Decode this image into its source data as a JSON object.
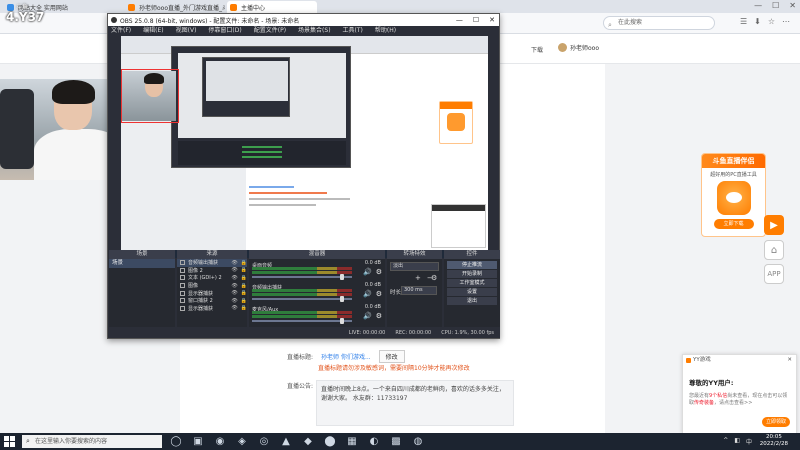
{
  "browser": {
    "tabs": [
      {
        "label": "网站大全 实用网站",
        "color": "#3a8ee6"
      },
      {
        "label": "孙老师ooo直播_外门游戏直播_斗鱼直播",
        "color": "#ff7d00"
      },
      {
        "label": "主播中心",
        "color": "#ff7d00",
        "active": true
      }
    ],
    "window_controls": [
      "—",
      "☐",
      "✕"
    ],
    "search_placeholder": "在此搜索",
    "toolbar_icons": [
      "☰",
      "⬇",
      "☆",
      "⋯"
    ]
  },
  "pagehead": {
    "download": "下载",
    "username": "孙老师ooo"
  },
  "form": {
    "room_title_label": "直播标题:",
    "room_title_value": "孙老师  你们游戏...",
    "edit_button": "修改",
    "warning": "直播标题请勿涉及敏感词，需要间隔10分钟才能再次修改",
    "notice_label": "直播公告:",
    "notice_text": "直播时间晚上8点。一个来自四川成都的老鲜肉，喜欢的话多多关注，谢谢大家。  水友群：11733197"
  },
  "ad": {
    "header": "斗鱼直播伴侣",
    "sub": "超好用的PC直播工具",
    "button": "立即下载"
  },
  "side_icons": {
    "play": "▶",
    "home": "⌂",
    "img": "APP"
  },
  "yy_popup": {
    "bar": "YY游戏",
    "close": "✕",
    "title": "尊敬的YY用户:",
    "text_pre": "您最近有",
    "text_hl1": "9个私信",
    "text_mid": "尚未查看，现在点击可以领取",
    "text_hl2": "传奇装备",
    "text_post": "，请点击查看>>",
    "button": "立即领取"
  },
  "overlay": {
    "brand_top": "斗鱼",
    "brand": "4.Y37"
  },
  "obs": {
    "title": "OBS 25.0.8 (64-bit, windows) - 配置文件: 未命名 - 场景: 未命名",
    "window_controls": [
      "—",
      "☐",
      "✕"
    ],
    "menu": [
      "文件(F)",
      "编辑(E)",
      "视图(V)",
      "停靠窗口(D)",
      "配置文件(P)",
      "场景集合(S)",
      "工具(T)",
      "帮助(H)"
    ],
    "docks": {
      "scenes": {
        "header": "场景",
        "items": [
          "场景"
        ],
        "footer": [
          "+",
          "−",
          "∧",
          "∨"
        ]
      },
      "sources": {
        "header": "来源",
        "items": [
          "音频输出捕获",
          "图像 2",
          "文本 (GDI+) 2",
          "图像",
          "显示器捕获",
          "窗口捕获 2",
          "显示器捕获"
        ],
        "eye": "👁",
        "lock": "🔒",
        "footer": [
          "+",
          "−",
          "⚙",
          "∧",
          "∨"
        ]
      },
      "mixer": {
        "header": "混音器",
        "channels": [
          {
            "name": "桌面音频",
            "db": "0.0 dB",
            "level": 0.9
          },
          {
            "name": "音频输出捕获",
            "db": "0.0 dB",
            "level": 0.9
          },
          {
            "name": "麦克风/Aux",
            "db": "0.0 dB",
            "level": 0.9
          }
        ],
        "speaker": "🔊",
        "gear": "⚙"
      },
      "transition": {
        "header": "转场特效",
        "selected": "淡出",
        "plus": "+",
        "minus": "−",
        "gear": "⚙",
        "duration_label": "时长",
        "duration_value": "300 ms"
      },
      "controls": {
        "header": "控件",
        "buttons": [
          "停止推流",
          "开始录制",
          "工作室模式",
          "设置",
          "退出"
        ]
      }
    },
    "status": [
      "LIVE: 00:00:00",
      "REC: 00:00:00",
      "CPU: 1.9%, 30.00 fps"
    ]
  },
  "taskbar": {
    "search_placeholder": "在这里输入你要搜索的内容",
    "apps": [
      "◯",
      "▣",
      "◉",
      "◈",
      "◎",
      "▲",
      "◆",
      "⬤",
      "▦",
      "◐",
      "▩",
      "◍"
    ],
    "tray": [
      "^",
      "◧",
      "中"
    ],
    "time": "20:05",
    "date": "2022/2/28"
  }
}
